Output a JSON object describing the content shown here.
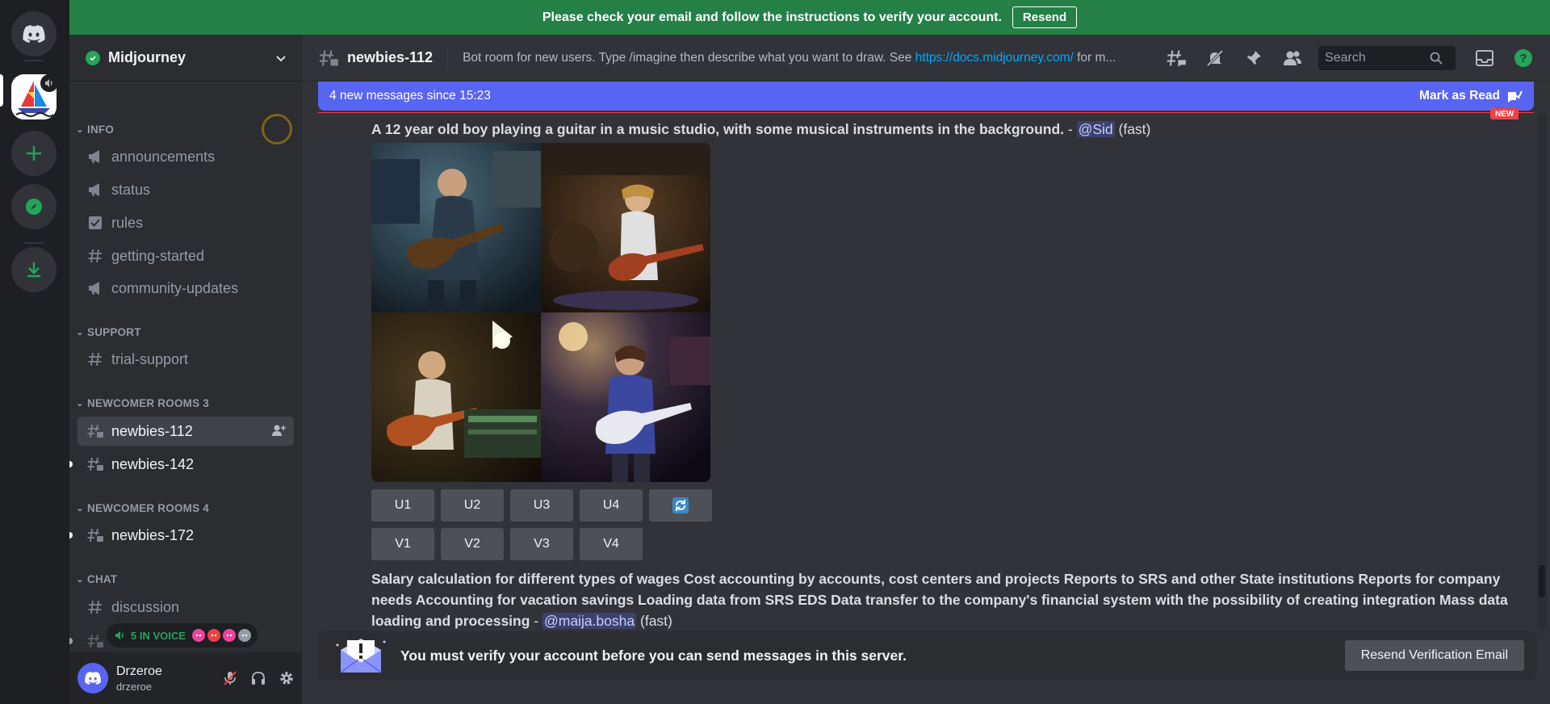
{
  "banner": {
    "text": "Please check your email and follow the instructions to verify your account.",
    "resend_label": "Resend"
  },
  "guild": {
    "name": "Midjourney"
  },
  "sidebar": {
    "categories": [
      {
        "label": "INFO"
      },
      {
        "label": "SUPPORT"
      },
      {
        "label": "NEWCOMER ROOMS 3"
      },
      {
        "label": "NEWCOMER ROOMS 4"
      },
      {
        "label": "CHAT"
      }
    ],
    "channels": [
      {
        "label": "announcements",
        "icon": "megaphone-icon"
      },
      {
        "label": "status",
        "icon": "megaphone-icon"
      },
      {
        "label": "rules",
        "icon": "checkbox-icon"
      },
      {
        "label": "getting-started",
        "icon": "hash-icon"
      },
      {
        "label": "community-updates",
        "icon": "megaphone-icon"
      },
      {
        "label": "trial-support",
        "icon": "hash-icon"
      },
      {
        "label": "newbies-112",
        "icon": "hash-thread-icon"
      },
      {
        "label": "newbies-142",
        "icon": "hash-thread-icon"
      },
      {
        "label": "newbies-172",
        "icon": "hash-thread-icon"
      },
      {
        "label": "discussion",
        "icon": "hash-icon"
      }
    ],
    "voice_label": "5 IN VOICE"
  },
  "user": {
    "display_name": "Drzeroe",
    "username": "drzeroe"
  },
  "header": {
    "channel": "newbies-112",
    "topic_prefix": "Bot room for new users. Type /imagine then describe what you want to draw. See ",
    "topic_link": "https://docs.midjourney.com/",
    "topic_suffix": " for m...",
    "search_placeholder": "Search"
  },
  "new_messages": {
    "text": "4 new messages since 15:23",
    "mark_read": "Mark as Read",
    "badge": "NEW"
  },
  "messages": [
    {
      "prompt": "A 12 year old boy playing a guitar in a music studio, with some musical instruments in the background.",
      "mention": "@Sid",
      "speed": "(fast)",
      "buttons_row1": [
        "U1",
        "U2",
        "U3",
        "U4"
      ],
      "buttons_row2": [
        "V1",
        "V2",
        "V3",
        "V4"
      ]
    },
    {
      "prompt": "Salary calculation for different types of wages Cost accounting by accounts, cost centers and projects Reports to SRS and other State institutions Reports for company needs Accounting for vacation savings Loading data from SRS EDS Data transfer to the company's financial system with the possibility of creating integration Mass data loading and processing",
      "mention": "@maija.bosha",
      "speed": "(fast)"
    }
  ],
  "verify": {
    "text": "You must verify your account before you can send messages in this server.",
    "button": "Resend Verification Email"
  },
  "colors": {
    "banner_green": "#248046",
    "blurple": "#5865f2",
    "link": "#00a8fc",
    "unread_red": "#f23f43"
  }
}
